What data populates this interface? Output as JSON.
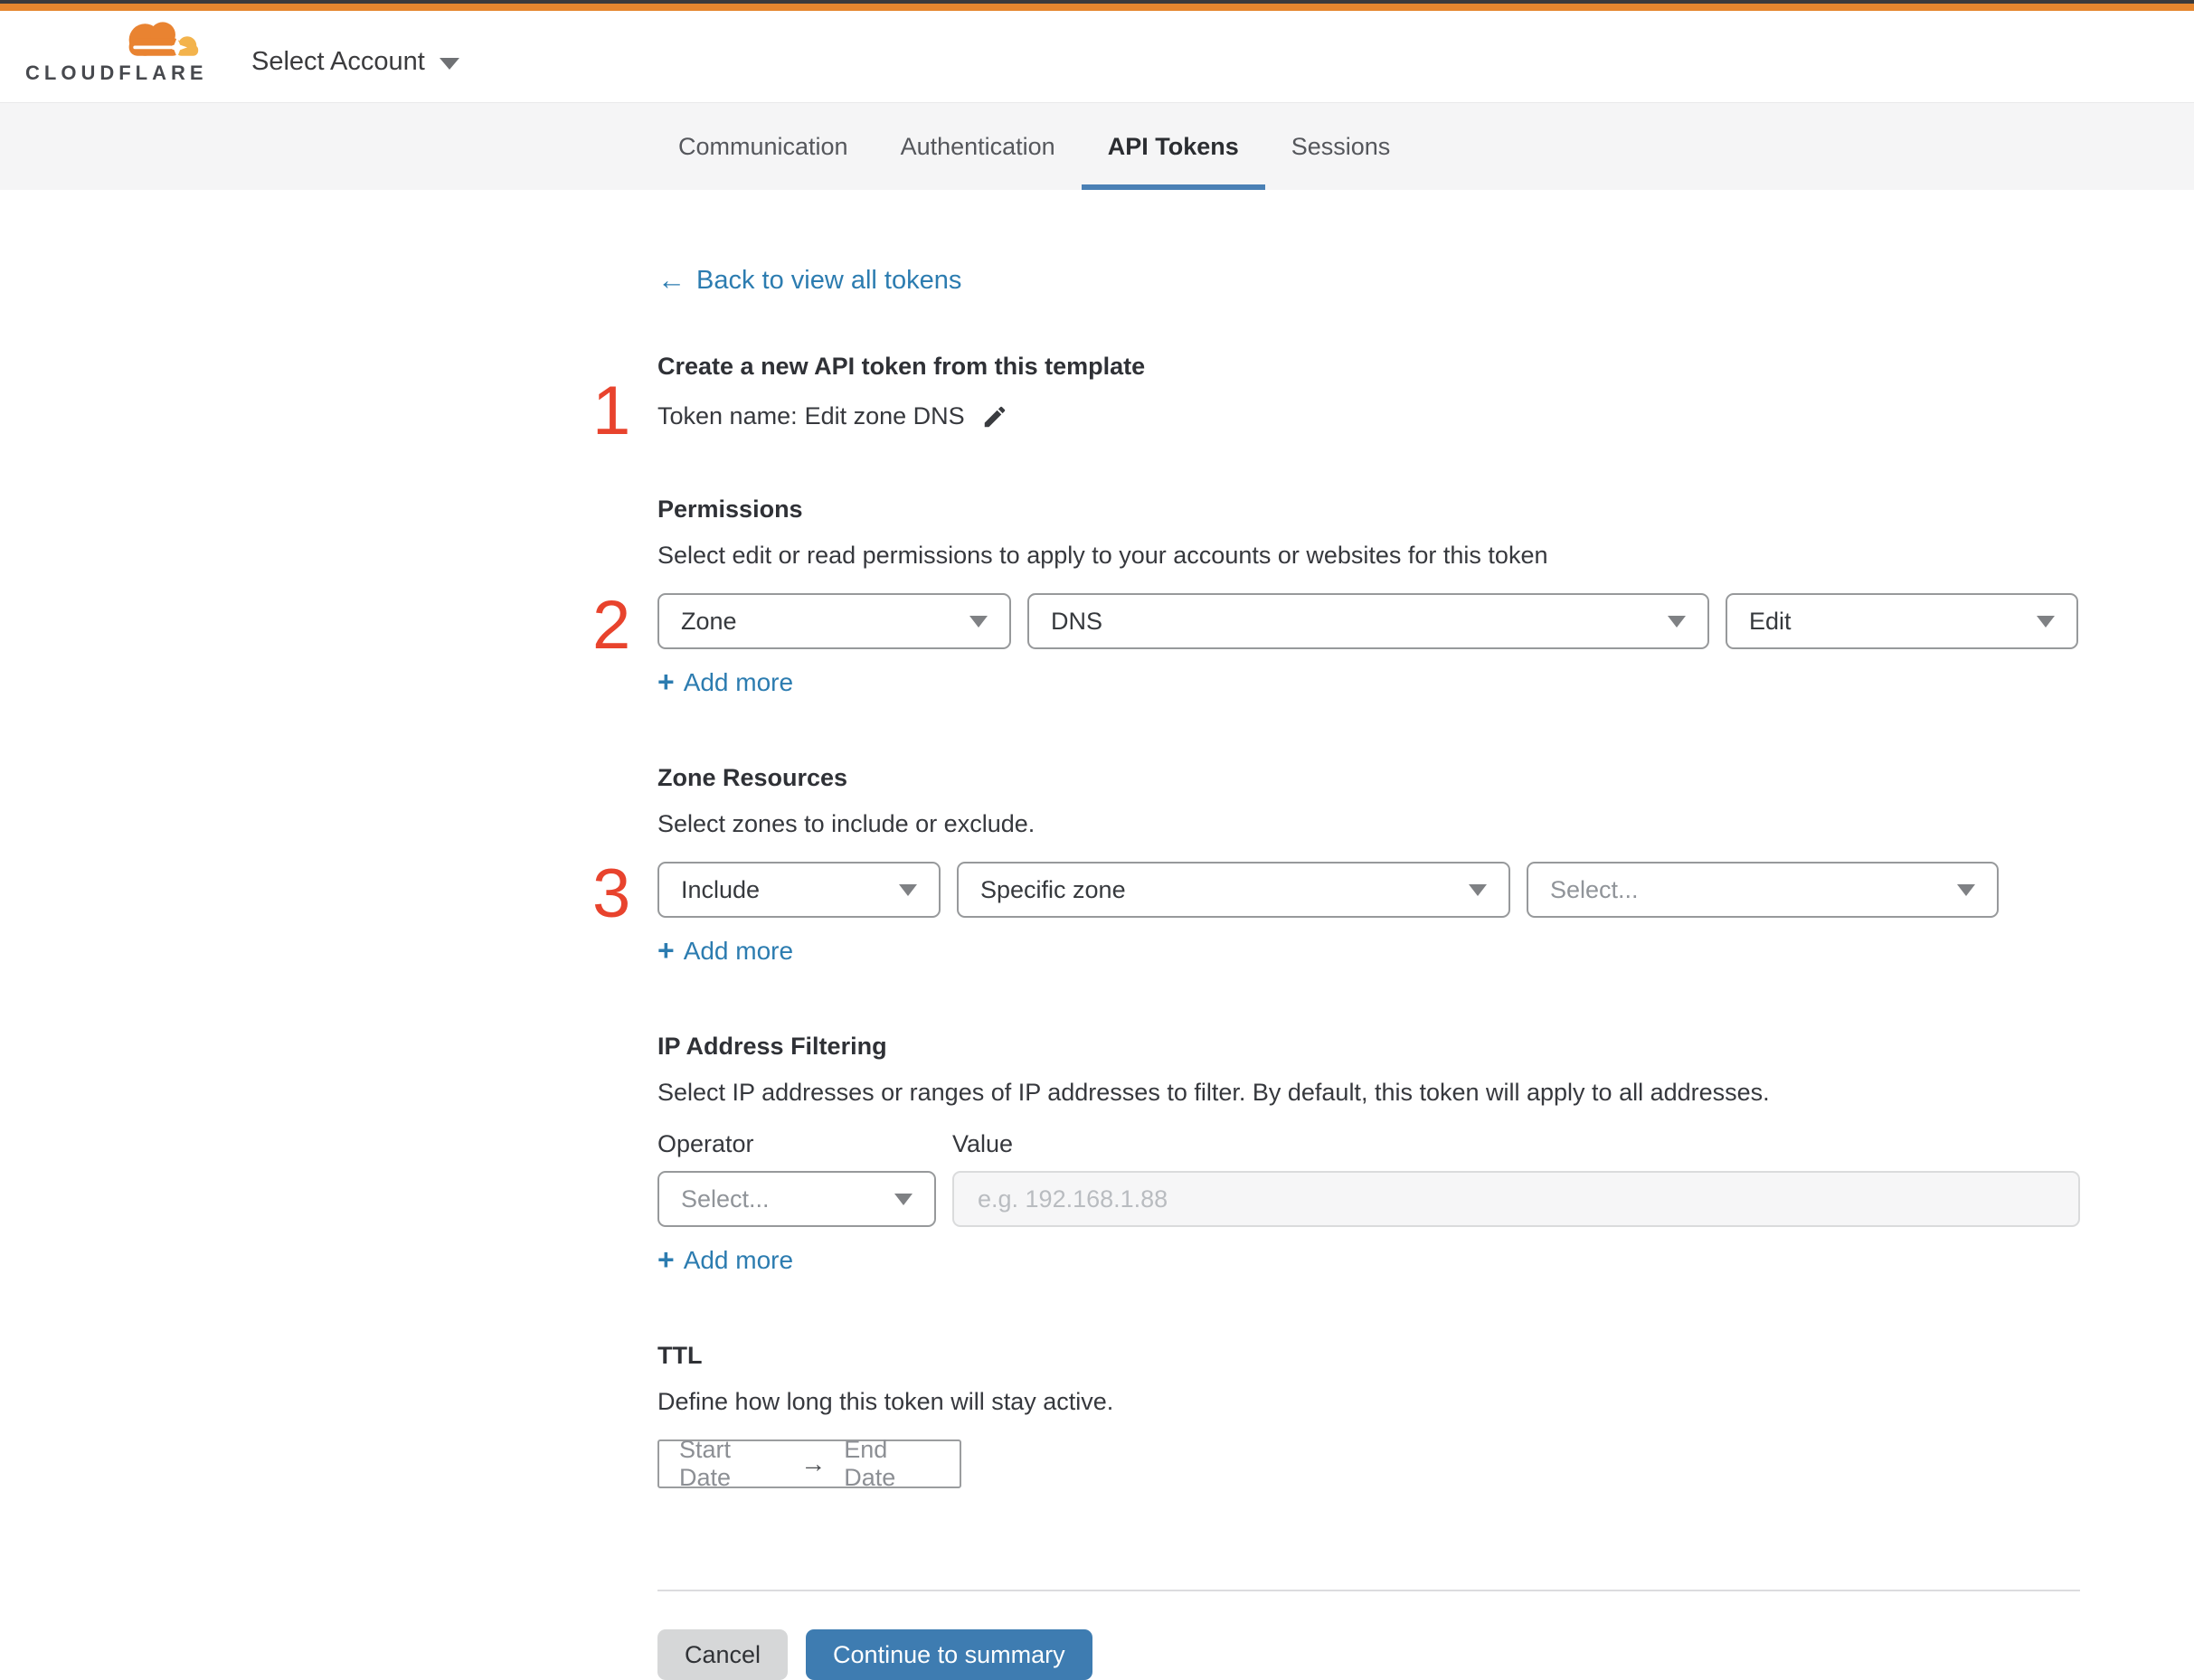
{
  "header": {
    "logo_text": "CLOUDFLARE",
    "account_label": "Select Account"
  },
  "tabs": {
    "items": [
      {
        "label": "Communication"
      },
      {
        "label": "Authentication"
      },
      {
        "label": "API Tokens"
      },
      {
        "label": "Sessions"
      }
    ],
    "active": "API Tokens"
  },
  "icons": {
    "back_arrow": "←",
    "plus": "+",
    "arrow_right": "→"
  },
  "back_link": {
    "label": "Back to view all tokens"
  },
  "intro": {
    "heading": "Create a new API token from this template",
    "token_name_label": "Token name:",
    "token_name_value": "Edit zone DNS"
  },
  "steps": {
    "one": "1",
    "two": "2",
    "three": "3"
  },
  "permissions": {
    "heading": "Permissions",
    "description": "Select edit or read permissions to apply to your accounts or websites for this token",
    "scope_value": "Zone",
    "service_value": "DNS",
    "access_value": "Edit",
    "add_more": "Add more"
  },
  "zone_resources": {
    "heading": "Zone Resources",
    "description": "Select zones to include or exclude.",
    "mode_value": "Include",
    "type_value": "Specific zone",
    "zone_placeholder": "Select...",
    "add_more": "Add more"
  },
  "ip_filtering": {
    "heading": "IP Address Filtering",
    "description": "Select IP addresses or ranges of IP addresses to filter. By default, this token will apply to all addresses.",
    "operator_label": "Operator",
    "value_label": "Value",
    "operator_placeholder": "Select...",
    "value_placeholder": "e.g. 192.168.1.88",
    "add_more": "Add more"
  },
  "ttl": {
    "heading": "TTL",
    "description": "Define how long this token will stay active.",
    "start_label": "Start Date",
    "end_label": "End Date"
  },
  "footer": {
    "cancel_label": "Cancel",
    "continue_label": "Continue to summary"
  },
  "colors": {
    "accent_orange": "#e5862f",
    "step_red": "#e8432d",
    "link_blue": "#2c7cb0",
    "button_blue": "#3e7cb1",
    "tab_underline": "#4a80b5",
    "tabbar_bg": "#f5f5f6"
  }
}
